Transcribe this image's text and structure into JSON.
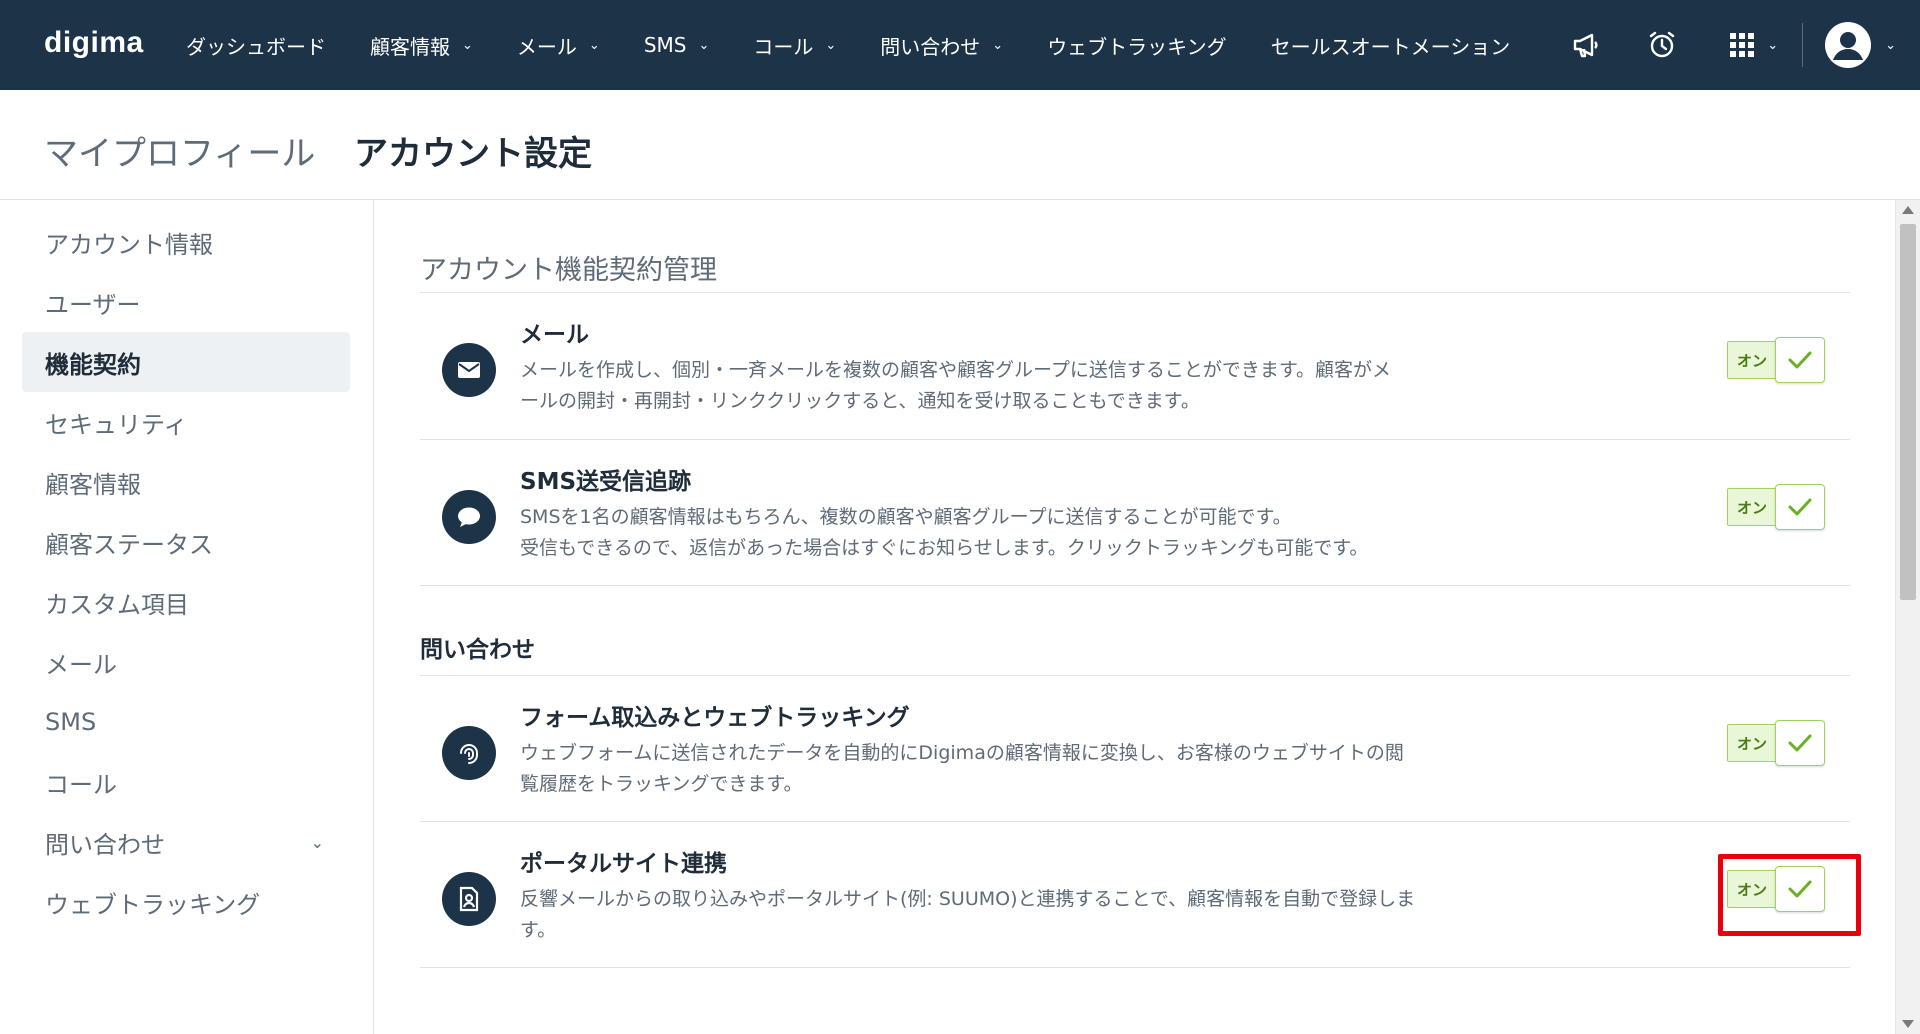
{
  "brand": {
    "logo_text": "digima"
  },
  "topnav": {
    "items": [
      {
        "label": "ダッシュボード",
        "has_dropdown": false
      },
      {
        "label": "顧客情報",
        "has_dropdown": true
      },
      {
        "label": "メール",
        "has_dropdown": true
      },
      {
        "label": "SMS",
        "has_dropdown": true
      },
      {
        "label": "コール",
        "has_dropdown": true
      },
      {
        "label": "問い合わせ",
        "has_dropdown": true
      },
      {
        "label": "ウェブトラッキング",
        "has_dropdown": false
      },
      {
        "label": "セールスオートメーション",
        "has_dropdown": false
      }
    ],
    "icons": [
      "megaphone-icon",
      "alarm-clock-icon",
      "apps-grid-icon",
      "user-avatar-icon"
    ]
  },
  "page_header": {
    "tab_inactive": "マイプロフィール",
    "tab_active": "アカウント設定"
  },
  "sidebar": {
    "items": [
      {
        "label": "アカウント情報"
      },
      {
        "label": "ユーザー"
      },
      {
        "label": "機能契約",
        "active": true
      },
      {
        "label": "セキュリティ"
      },
      {
        "label": "顧客情報"
      },
      {
        "label": "顧客ステータス"
      },
      {
        "label": "カスタム項目"
      },
      {
        "label": "メール"
      },
      {
        "label": "SMS"
      },
      {
        "label": "コール"
      },
      {
        "label": "問い合わせ",
        "expandable": true
      },
      {
        "label": "ウェブトラッキング"
      }
    ]
  },
  "main": {
    "section_title": "アカウント機能契約管理",
    "group_title": "問い合わせ",
    "features": [
      {
        "icon": "envelope-icon",
        "title": "メール",
        "desc_line1": "メールを作成し、個別・一斉メールを複数の顧客や顧客グループに送信することができます。顧客がメ",
        "desc_line2": "ールの開封・再開封・リンククリックすると、通知を受け取ることもできます。",
        "toggle_label": "オン",
        "enabled": true
      },
      {
        "icon": "chat-bubble-icon",
        "title": "SMS送受信追跡",
        "desc_line1": "SMSを1名の顧客情報はもちろん、複数の顧客や顧客グループに送信することが可能です。",
        "desc_line2": "受信もできるので、返信があった場合はすぐにお知らせします。クリックトラッキングも可能です。",
        "toggle_label": "オン",
        "enabled": true
      },
      {
        "icon": "fingerprint-icon",
        "title": "フォーム取込みとウェブトラッキング",
        "desc_line1": "ウェブフォームに送信されたデータを自動的にDigimaの顧客情報に変換し、お客様のウェブサイトの閲",
        "desc_line2": "覧履歴をトラッキングできます。",
        "toggle_label": "オン",
        "enabled": true
      },
      {
        "icon": "contact-document-icon",
        "title": "ポータルサイト連携",
        "desc_line1": "反響メールからの取り込みやポータルサイト(例: SUUMO)と連携することで、顧客情報を自動で登録しま",
        "desc_line2": "す。",
        "toggle_label": "オン",
        "enabled": true,
        "highlighted": true
      }
    ]
  },
  "colors": {
    "nav_bg": "#1c3348",
    "logo_accent": "#8cc63f",
    "toggle_on_border": "#9ed45a",
    "toggle_on_bg": "#eaf6d8",
    "check_color": "#6ab023",
    "highlight_border": "#e8000b"
  }
}
